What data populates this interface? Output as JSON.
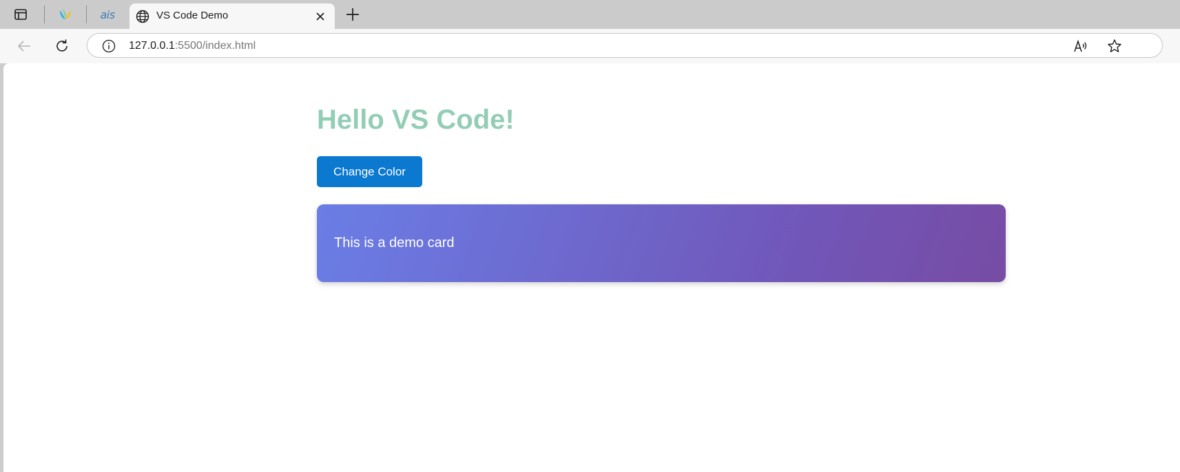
{
  "browser": {
    "tabs": {
      "active": {
        "title": "VS Code Demo"
      },
      "pinned": [
        {
          "icon": "multicolor-leaf-icon"
        },
        {
          "icon": "ais-icon",
          "text": "ais"
        }
      ]
    },
    "address_bar": {
      "url_host": "127.0.0.1",
      "url_rest": ":5500/index.html"
    }
  },
  "page": {
    "heading": "Hello VS Code!",
    "button_label": "Change Color",
    "card_text": "This is a demo card"
  },
  "colors": {
    "heading": "#93cdb5",
    "button": "#0a79cf",
    "card_gradient_start": "#6a7ee6",
    "card_gradient_end": "#774ca4"
  }
}
